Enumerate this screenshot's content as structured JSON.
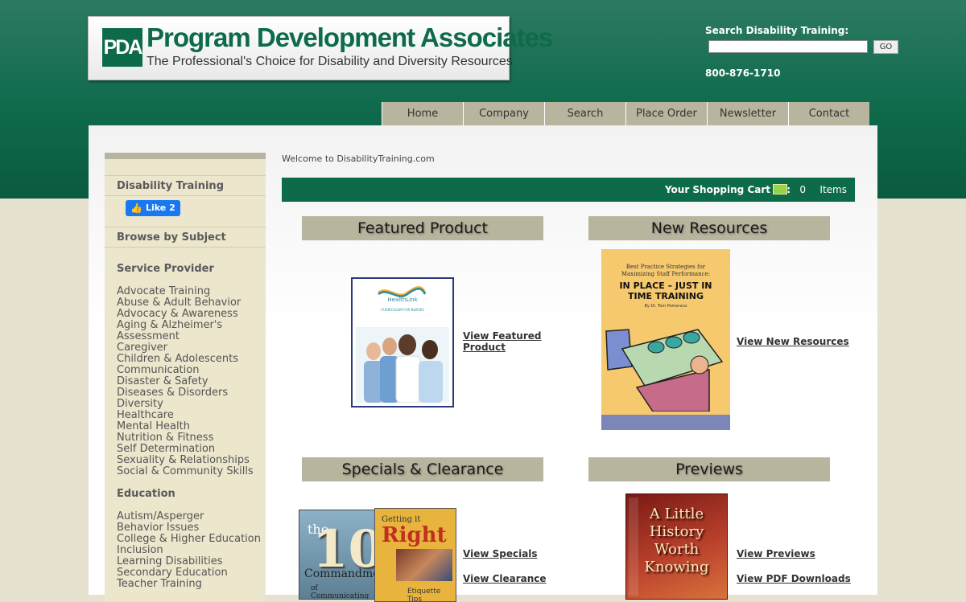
{
  "header": {
    "logo_mark": "PDA",
    "logo_name": "Program Development Associates",
    "logo_tagline": "The Professional's Choice for Disability and Diversity Resources",
    "search_label": "Search Disability Training:",
    "search_value": "",
    "go_label": "GO",
    "phone": "800-876-1710"
  },
  "nav": {
    "items": [
      "Home",
      "Company",
      "Search",
      "Place Order",
      "Newsletter",
      "Contact"
    ]
  },
  "sidebar": {
    "disability_training": "Disability Training",
    "like_label": "Like 2",
    "browse_by_subject": "Browse by Subject",
    "service_provider": "Service Provider",
    "service_items": [
      "Advocate Training",
      "Abuse & Adult Behavior",
      "Advocacy & Awareness",
      "Aging & Alzheimer's",
      "Assessment",
      "Caregiver",
      "Children & Adolescents",
      "Communication",
      "Disaster & Safety",
      "Diseases & Disorders",
      "Diversity",
      "Healthcare",
      "Mental Health",
      "Nutrition & Fitness",
      "Self Determination",
      "Sexuality & Relationships",
      "Social & Community Skills"
    ],
    "education": "Education",
    "education_items": [
      "Autism/Asperger",
      "Behavior Issues",
      "College & Higher Education",
      "Inclusion",
      "Learning Disabilities",
      "Secondary Education",
      "Teacher Training"
    ]
  },
  "main": {
    "welcome": "Welcome to DisabilityTraining.com",
    "cart": {
      "label": "Your Shopping Cart",
      "colon": ":",
      "count": "0",
      "items_label": "Items"
    },
    "featured": {
      "title": "Featured Product",
      "link_line1": "View Featured",
      "link_line2": "Product"
    },
    "new_resources": {
      "title": "New Resources",
      "link": "View New Resources"
    },
    "specials": {
      "title": "Specials & Clearance",
      "link_specials": "View Specials",
      "link_clearance": "View Clearance"
    },
    "previews": {
      "title": "Previews",
      "link_previews": "View Previews",
      "link_pdf": "View PDF Downloads"
    }
  },
  "products": {
    "healthlink": {
      "brand": "HealthLink",
      "subtitle": "CURRICULUM FOR NURSES"
    },
    "inplace": {
      "top_line1": "Best Practice Strategies for",
      "top_line2": "Maximizing Staff Performance:",
      "title_line1": "IN PLACE – JUST IN",
      "title_line2": "TIME TRAINING",
      "author": "By Dr. Tom Pomeranz"
    },
    "ten_commandments": {
      "the": "the",
      "ten": "10",
      "commandments": "Commandments",
      "of": "of Communicating"
    },
    "getting_it_right": {
      "getting": "Getting it",
      "right": "Right",
      "etiquette": "Etiquette Tips"
    },
    "history": {
      "line1": "A Little History",
      "line2": "Worth Knowing"
    }
  },
  "colors": {
    "brand_green": "#0e6b4a",
    "tan": "#b7b59d",
    "sidebar_bg": "#ebe6cc",
    "fb_blue": "#1877f2"
  }
}
